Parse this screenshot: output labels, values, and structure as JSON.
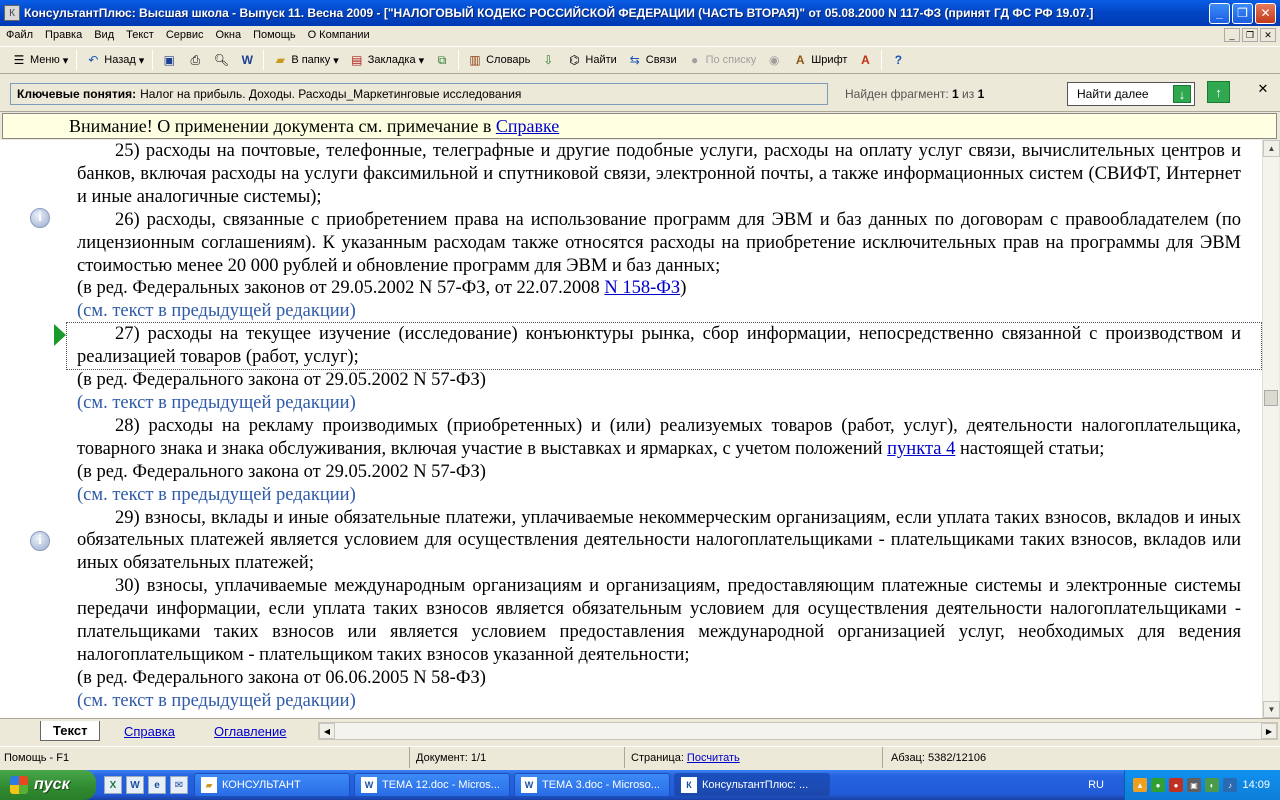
{
  "window": {
    "title": "КонсультантПлюс: Высшая школа - Выпуск 11. Весна 2009 - [\"НАЛОГОВЫЙ КОДЕКС РОССИЙСКОЙ ФЕДЕРАЦИИ (ЧАСТЬ ВТОРАЯ)\" от 05.08.2000 N 117-ФЗ (принят ГД ФС РФ 19.07.]"
  },
  "menu": [
    "Файл",
    "Правка",
    "Вид",
    "Текст",
    "Сервис",
    "Окна",
    "Помощь",
    "О Компании"
  ],
  "toolbar": {
    "menu": "Меню",
    "back": "Назад",
    "to_folder": "В папку",
    "bookmark": "Закладка",
    "dictionary": "Словарь",
    "find": "Найти",
    "links": "Связи",
    "by_list": "По списку",
    "font": "Шрифт"
  },
  "search": {
    "key_label": "Ключевые понятия:",
    "key_value": "Налог на прибыль. Доходы. Расходы_Маркетинговые исследования",
    "found_prefix": "Найден фрагмент:",
    "found_current": "1",
    "found_sep": "из",
    "found_total": "1",
    "find_next": "Найти далее"
  },
  "warning": {
    "text": "Внимание! О применении документа см. примечание в",
    "link": "Справке"
  },
  "doc": {
    "p25": "25) расходы на почтовые, телефонные, телеграфные и другие подобные услуги, расходы на оплату услуг связи, вычислительных центров и банков, включая расходы на услуги факсимильной и спутниковой связи, электронной почты, а также информационных систем (СВИФТ, Интернет и иные аналогичные системы);",
    "p26": "26) расходы, связанные с приобретением права на использование программ для ЭВМ и баз данных по договорам с правообладателем (по лицензионным соглашениям). К указанным расходам также относятся расходы на приобретение исключительных прав на программы для ЭВМ стоимостью менее 20 000 рублей и обновление программ для ЭВМ и баз данных;",
    "red26_text": "(в ред. Федеральных законов от 29.05.2002 N 57-ФЗ, от 22.07.2008",
    "red26_link": "N 158-ФЗ",
    "red26_end": ")",
    "prev_text": "(см. текст в предыдущей редакции)",
    "p27": "27) расходы на текущее изучение (исследование) конъюнктуры рынка, сбор информации, непосредственно связанной с производством и реализацией товаров (работ, услуг);",
    "red27": "(в ред. Федерального закона от 29.05.2002 N 57-ФЗ)",
    "p28_text": "28) расходы на рекламу производимых (приобретенных) и (или) реализуемых товаров (работ, услуг), деятельности налогоплательщика, товарного знака и знака обслуживания, включая участие в выставках и ярмарках, с учетом положений",
    "p28_link": "пункта 4",
    "p28_end": "настоящей статьи;",
    "red28": "(в ред. Федерального закона от 29.05.2002 N 57-ФЗ)",
    "p29": "29) взносы, вклады и иные обязательные платежи, уплачиваемые некоммерческим организациям, если уплата таких взносов, вкладов и иных обязательных платежей является условием для осуществления деятельности налогоплательщиками - плательщиками таких взносов, вкладов или иных обязательных платежей;",
    "p30": "30) взносы, уплачиваемые международным организациям и организациям, предоставляющим платежные системы и электронные системы передачи информации, если уплата таких взносов является обязательным условием для осуществления деятельности налогоплательщиками - плательщиками таких взносов или является условием предоставления международной организацией услуг, необходимых для ведения налогоплательщиком - плательщиком таких взносов указанной деятельности;",
    "red30": "(в ред. Федерального закона от 06.06.2005 N 58-ФЗ)",
    "prev_cut": "(см. текст в предыдущей редакции)"
  },
  "tabs": {
    "text": "Текст",
    "help": "Справка",
    "contents": "Оглавление"
  },
  "status": {
    "help": "Помощь - F1",
    "document": "Документ: 1/1",
    "page_label": "Страница:",
    "page_link": "Посчитать",
    "paragraph": "Абзац: 5382/12106"
  },
  "taskbar": {
    "start": "пуск",
    "tasks": [
      "КОНСУЛЬТАНТ",
      "ТЕМА 12.doc - Micros...",
      "ТЕМА 3.doc - Microso...",
      "КонсультантПлюс: ..."
    ],
    "lang": "RU",
    "clock": "14:09"
  }
}
